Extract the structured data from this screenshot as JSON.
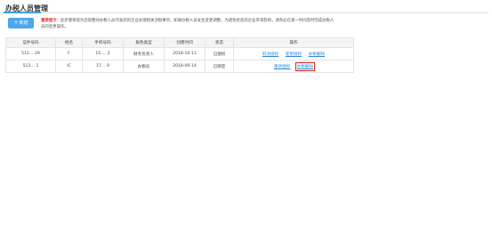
{
  "page": {
    "title": "办税人员管理"
  },
  "toolbar": {
    "add_label": "新增",
    "add_icon": "plus-icon"
  },
  "notice": {
    "label": "重要提示：",
    "text": "此步骤将现为您现整块办税人员代表您的企业办理相关涉税事项，如果办税人员发生变更调整，为避免给您的企业带来影响，请务必在第一时间及时完成办税人员的变更操作。"
  },
  "table": {
    "headers": [
      "证件号码",
      "姓名",
      "手机号码",
      "角色类型",
      "创建时间",
      "状态",
      "操作"
    ],
    "rows": [
      {
        "id_number": "511…      29",
        "name": "F",
        "phone": "15…      .2",
        "role": "财务负责人",
        "created": "2018-10-11",
        "status": "已授权",
        "ops": [
          {
            "label": "取消授权",
            "highlighted": false
          },
          {
            "label": "变更授权",
            "highlighted": false
          },
          {
            "label": "办税删除",
            "highlighted": false
          }
        ]
      },
      {
        "id_number": "513…      1",
        "name": "IC",
        "phone": "17…      9",
        "role": "办税员",
        "created": "2018-09-14",
        "status": "已绑定",
        "ops": [
          {
            "label": "重新授权",
            "highlighted": false
          },
          {
            "label": "办税删除",
            "highlighted": true
          }
        ]
      }
    ]
  }
}
